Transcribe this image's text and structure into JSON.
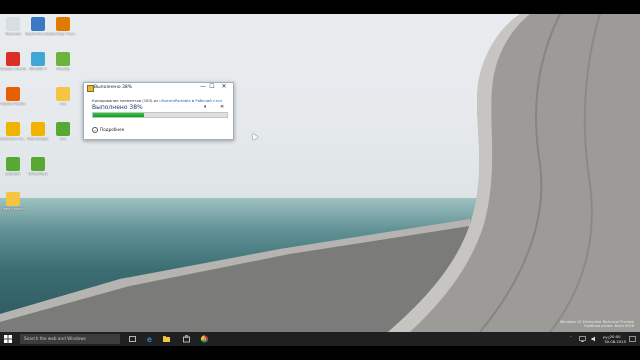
{
  "desktop_icons": [
    {
      "label": "Корзина",
      "icon": "recycle-bin-icon",
      "color": "#d7dde3"
    },
    {
      "label": "Recommended Media",
      "icon": "media-icon",
      "color": "#3a78c6"
    },
    {
      "label": "Hamster Free ZIP Archiver",
      "icon": "archiver-icon",
      "color": "#e07a00"
    },
    {
      "label": "Google Chrome",
      "icon": "chrome-icon",
      "color": "#d93025"
    },
    {
      "label": "WinRAR 4",
      "icon": "winrar-icon",
      "color": "#3fa7d6"
    },
    {
      "label": "FreeZip",
      "icon": "freezip-icon",
      "color": "#6db33f"
    },
    {
      "label": "Mozilla Firefox",
      "icon": "firefox-icon",
      "color": "#e66000"
    },
    {
      "label": "xxx",
      "icon": "folder-icon",
      "color": "#f5c542"
    },
    {
      "label": "Extension Ex...",
      "icon": "extension-icon",
      "color": "#f0b400"
    },
    {
      "label": "Mail вопрос",
      "icon": "mail-icon",
      "color": "#f0b400"
    },
    {
      "label": "xxx",
      "icon": "utorrent-small-icon",
      "color": "#58a934"
    },
    {
      "label": "µtorrent",
      "icon": "utorrent-icon",
      "color": "#58a934"
    },
    {
      "label": "DriverPack",
      "icon": "driverpack-icon",
      "color": "#58a934"
    },
    {
      "label": "Новая папка",
      "icon": "new-folder-icon",
      "color": "#f5c542"
    }
  ],
  "dialog": {
    "title": "Выполнено 38%",
    "line_prefix": "Копирование элементов (183) из ",
    "source": "uTorrentPortable",
    "line_mid": " в ",
    "destination": "Рабочий стол",
    "percent_label": "Выполнено 38%",
    "progress": 0.38,
    "pause_symbol": "⏸",
    "cancel_symbol": "✕",
    "min_symbol": "—",
    "max_symbol": "☐",
    "close_symbol": "✕",
    "more_label": "Подробнее",
    "more_symbol": "⌄"
  },
  "watermark": {
    "line1": "Windows 10 Enterprise Technical Preview",
    "line2": "Пробная копия. Build 9926"
  },
  "taskbar": {
    "search_placeholder": "Search the web and Windows",
    "tray_lang": "РУС",
    "clock_time": "20:00",
    "clock_date": "30.08.2015",
    "accent": "#1f2022"
  }
}
